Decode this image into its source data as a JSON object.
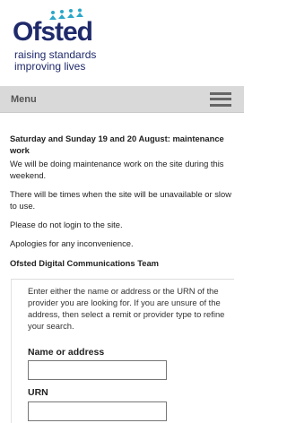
{
  "header": {
    "logo_name": "Ofsted",
    "logo_tagline_line1": "raising standards",
    "logo_tagline_line2": "improving lives"
  },
  "nav": {
    "menu_label": "Menu"
  },
  "notice": {
    "heading": "Saturday and Sunday 19 and 20 August: maintenance work",
    "para1": "We will be doing maintenance work on the site during this weekend.",
    "para2": "There will be times when the site will be unavailable or slow to use.",
    "para3": "Please do not login to the site.",
    "para4": "Apologies for any inconvenience.",
    "signoff": "Ofsted Digital Communications Team"
  },
  "search": {
    "intro": "Enter either the name or address or the URN of the provider you are looking for. If you are unsure of the address, then select a remit or provider type to refine your search.",
    "name_label": "Name or address",
    "name_value": "",
    "urn_label": "URN",
    "urn_value": ""
  },
  "colors": {
    "brand_navy": "#1f2a6b",
    "brand_teal": "#2aa7c9",
    "menu_bar": "#d9d9d9"
  }
}
